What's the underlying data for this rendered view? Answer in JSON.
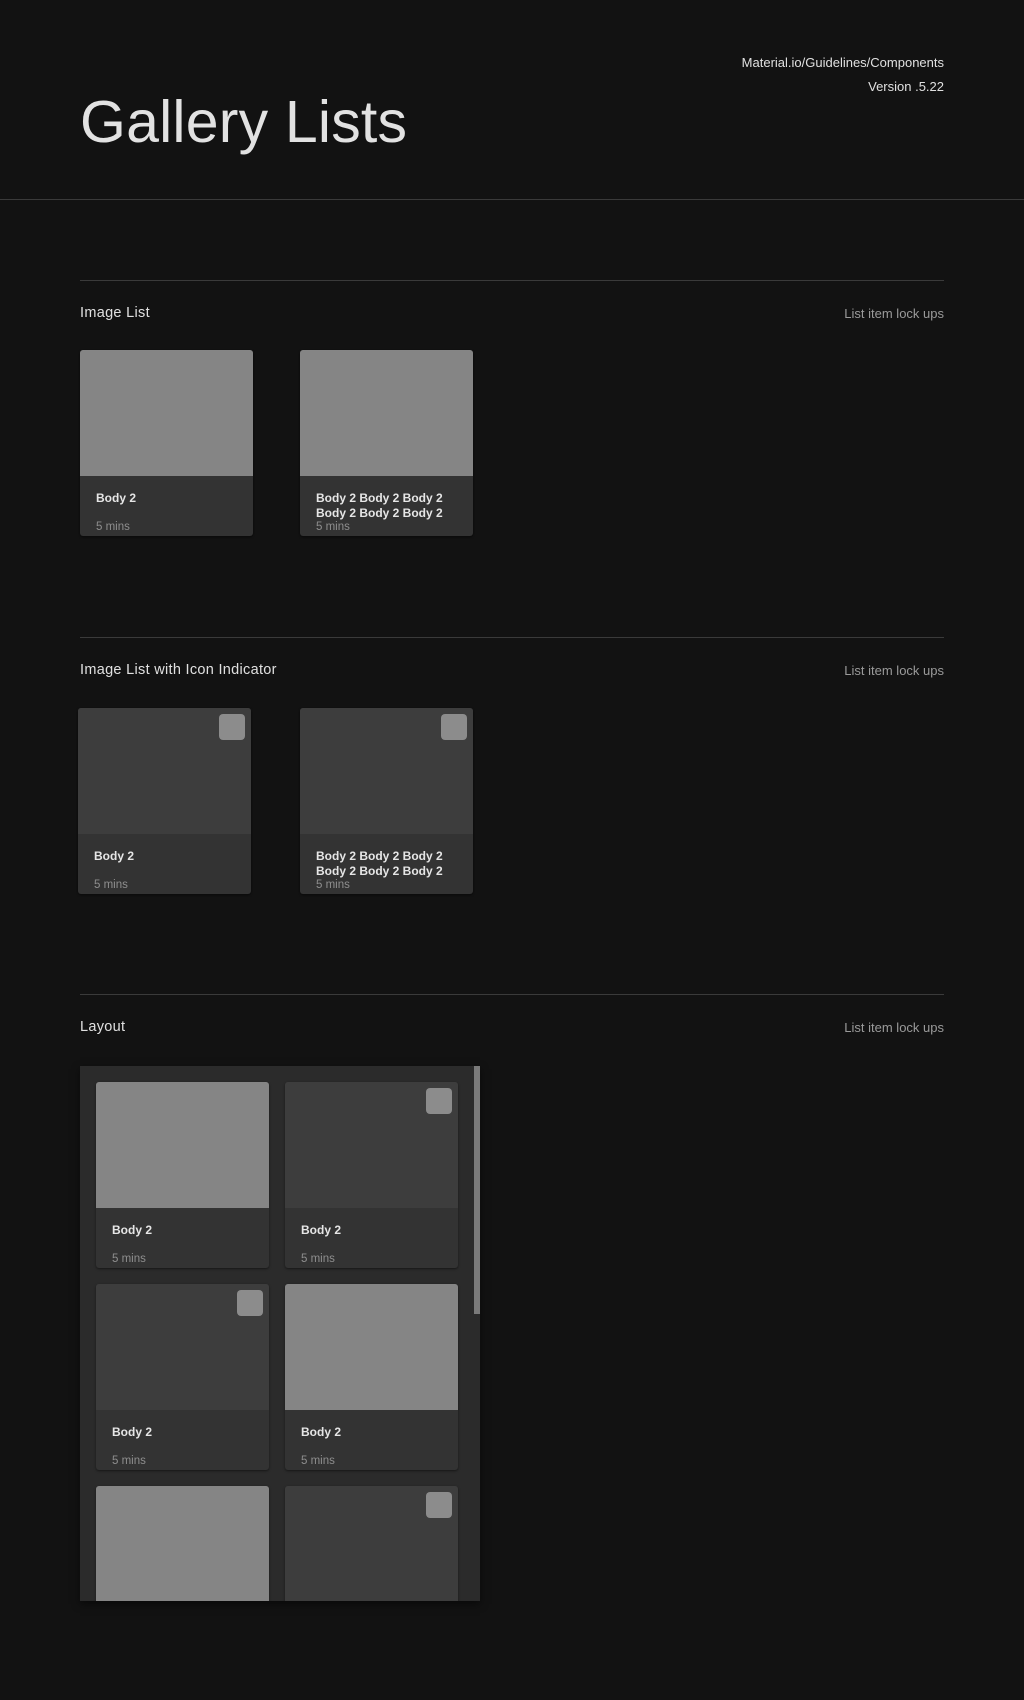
{
  "header": {
    "title": "Gallery Lists",
    "path": "Material.io/Guidelines/Components",
    "version": "Version .5.22"
  },
  "sections": [
    {
      "title": "Image List",
      "note": "List item lock ups",
      "cards": [
        {
          "label": "Body 2",
          "time": "5 mins",
          "image": "light",
          "indicator": false
        },
        {
          "label": "Body 2 Body 2 Body 2 Body 2 Body 2 Body 2",
          "time": "5 mins",
          "image": "light",
          "indicator": false
        }
      ]
    },
    {
      "title": "Image List with Icon Indicator",
      "note": "List item lock ups",
      "cards": [
        {
          "label": "Body 2",
          "time": "5 mins",
          "image": "dark",
          "indicator": true
        },
        {
          "label": "Body 2 Body 2 Body 2 Body 2 Body 2 Body 2",
          "time": "5 mins",
          "image": "dark",
          "indicator": true
        }
      ]
    },
    {
      "title": "Layout",
      "note": "List item lock ups",
      "cards": [
        {
          "label": "Body 2",
          "time": "5 mins",
          "image": "light",
          "indicator": false
        },
        {
          "label": "Body 2",
          "time": "5 mins",
          "image": "dark",
          "indicator": true
        },
        {
          "label": "Body 2",
          "time": "5 mins",
          "image": "dark",
          "indicator": true
        },
        {
          "label": "Body 2",
          "time": "5 mins",
          "image": "light",
          "indicator": false
        },
        {
          "label": "",
          "time": "",
          "image": "light",
          "indicator": false
        },
        {
          "label": "",
          "time": "",
          "image": "dark",
          "indicator": true
        }
      ]
    }
  ],
  "colors": {
    "background": "#121212",
    "card": "#333333",
    "image_light": "#858585",
    "image_dark": "#3d3d3d",
    "indicator": "#8c8c8c"
  }
}
